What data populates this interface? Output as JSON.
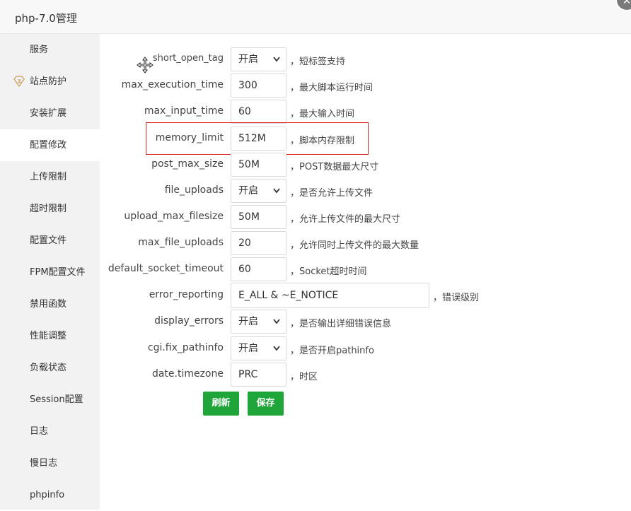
{
  "window": {
    "title": "php-7.0管理",
    "close_icon": "close-icon"
  },
  "sidebar": {
    "items": [
      {
        "label": "服务"
      },
      {
        "label": "站点防护",
        "icon": "shield-diamond-icon"
      },
      {
        "label": "安装扩展"
      },
      {
        "label": "配置修改",
        "active": true
      },
      {
        "label": "上传限制"
      },
      {
        "label": "超时限制"
      },
      {
        "label": "配置文件"
      },
      {
        "label": "FPM配置文件"
      },
      {
        "label": "禁用函数"
      },
      {
        "label": "性能调整"
      },
      {
        "label": "负载状态"
      },
      {
        "label": "Session配置"
      },
      {
        "label": "日志"
      },
      {
        "label": "慢日志"
      },
      {
        "label": "phpinfo"
      }
    ]
  },
  "settings": [
    {
      "key": "short_open_tag",
      "type": "select",
      "value": "开启",
      "desc": "，短标签支持"
    },
    {
      "key": "max_execution_time",
      "type": "input",
      "value": "300",
      "desc": "，最大脚本运行时间"
    },
    {
      "key": "max_input_time",
      "type": "input",
      "value": "60",
      "desc": "，最大输入时间"
    },
    {
      "key": "memory_limit",
      "type": "input",
      "value": "512M",
      "desc": "，脚本内存限制"
    },
    {
      "key": "post_max_size",
      "type": "input",
      "value": "50M",
      "desc": "，POST数据最大尺寸"
    },
    {
      "key": "file_uploads",
      "type": "select",
      "value": "开启",
      "desc": "，是否允许上传文件"
    },
    {
      "key": "upload_max_filesize",
      "type": "input",
      "value": "50M",
      "desc": "，允许上传文件的最大尺寸"
    },
    {
      "key": "max_file_uploads",
      "type": "input",
      "value": "20",
      "desc": "，允许同时上传文件的最大数量"
    },
    {
      "key": "default_socket_timeout",
      "type": "input",
      "value": "60",
      "desc": "，Socket超时时间"
    },
    {
      "key": "error_reporting",
      "type": "input-wide",
      "value": "E_ALL & ~E_NOTICE",
      "desc": "，错误级别"
    },
    {
      "key": "display_errors",
      "type": "select",
      "value": "开启",
      "desc": "，是否输出详细错误信息"
    },
    {
      "key": "cgi.fix_pathinfo",
      "type": "select",
      "value": "开启",
      "desc": "，是否开启pathinfo"
    },
    {
      "key": "date.timezone",
      "type": "input",
      "value": "PRC",
      "desc": "，时区"
    }
  ],
  "buttons": {
    "refresh": "刷新",
    "save": "保存"
  },
  "colors": {
    "accent": "#20a53a",
    "highlight_border": "#e0252a",
    "sidebar_bg": "#f2f2f2"
  }
}
